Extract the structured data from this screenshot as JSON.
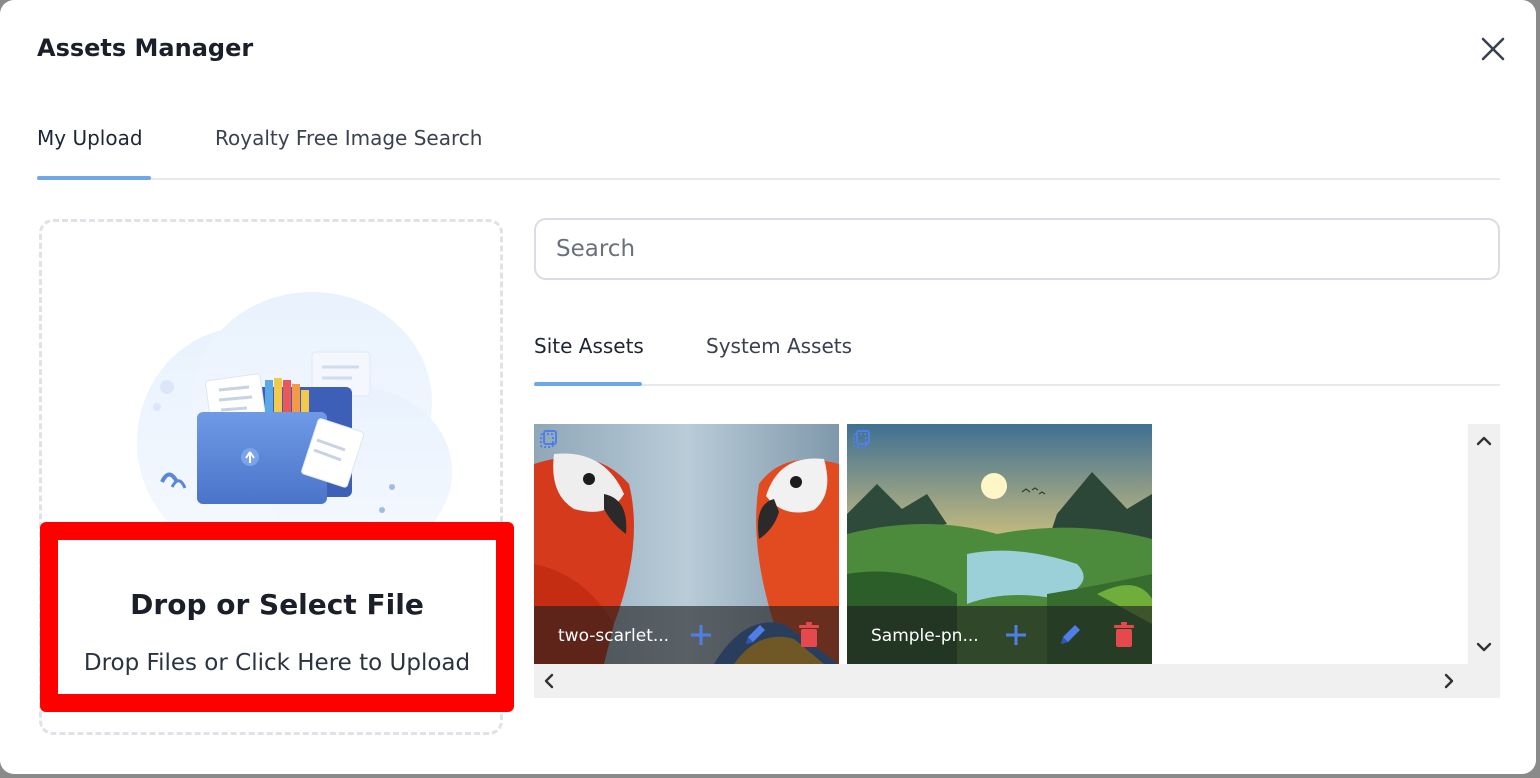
{
  "dialog": {
    "title": "Assets Manager"
  },
  "tabs": [
    {
      "label": "My Upload",
      "active": true
    },
    {
      "label": "Royalty Free Image Search",
      "active": false
    }
  ],
  "dropzone": {
    "title": "Drop or Select File",
    "subtitle": "Drop Files or Click Here to Upload"
  },
  "search": {
    "placeholder": "Search",
    "value": ""
  },
  "subtabs": [
    {
      "label": "Site Assets",
      "active": true
    },
    {
      "label": "System Assets",
      "active": false
    }
  ],
  "assets": [
    {
      "name": "two-scarlet...",
      "icons": [
        "image-type-icon",
        "plus-icon",
        "pencil-icon",
        "trash-icon"
      ]
    },
    {
      "name": "Sample-pn...",
      "icons": [
        "image-type-icon",
        "plus-icon",
        "pencil-icon",
        "trash-icon"
      ]
    }
  ],
  "colors": {
    "accent": "#6ea8e8",
    "highlight": "#ff0000",
    "delete": "#e5484d",
    "action": "#4f7fe6"
  }
}
